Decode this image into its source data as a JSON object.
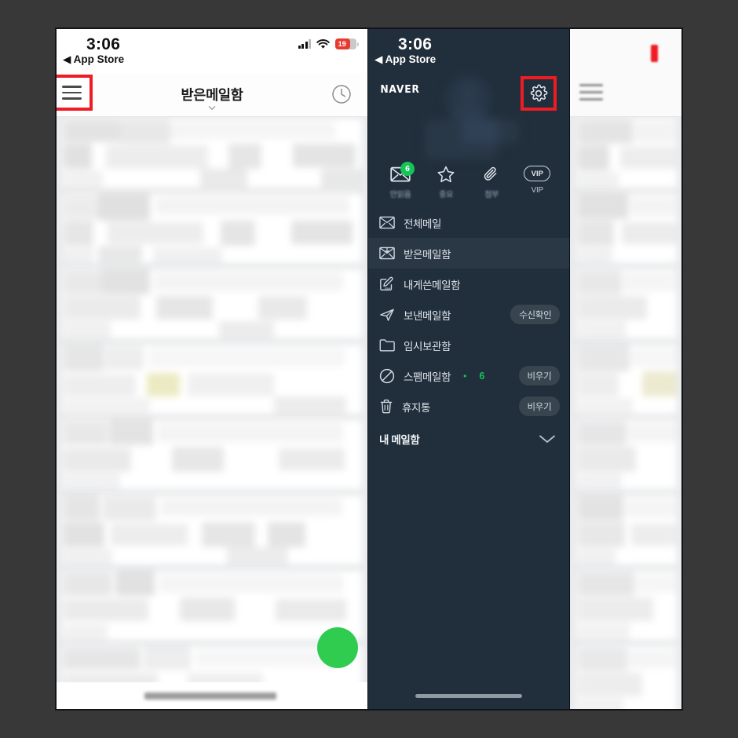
{
  "meta": {
    "outer_bg": "#383838",
    "accent_red": "#ee1c24",
    "accent_green": "#16c45a",
    "dark_panel_bg": "#212e3b",
    "active_row_bg": "#2a3744"
  },
  "left_panel": {
    "status_bar": {
      "time": "3:06",
      "back_label": "App Store",
      "back_arrow": "◀",
      "battery_percent": "19",
      "signal_icon": "signal-bars-icon",
      "wifi_icon": "wifi-icon",
      "battery_icon": "battery-icon"
    },
    "navbar": {
      "menu_icon": "hamburger-menu-icon",
      "title": "받은메일함",
      "caret_icon": "chevron-down-icon",
      "clock_icon": "clock-icon"
    },
    "compose_button": "compose-fab",
    "list_items": [
      {
        "id": "mail-1"
      },
      {
        "id": "mail-2"
      },
      {
        "id": "mail-3"
      },
      {
        "id": "mail-4"
      },
      {
        "id": "mail-5"
      },
      {
        "id": "mail-6"
      },
      {
        "id": "mail-7"
      },
      {
        "id": "mail-8"
      }
    ]
  },
  "mid_panel": {
    "status_bar": {
      "time": "3:06",
      "back_label": "App Store",
      "back_arrow": "◀"
    },
    "brand": "NAVER",
    "settings_icon": "gear-icon",
    "avatar": "user-avatar",
    "quick_access": [
      {
        "icon": "unread-envelope-icon",
        "label": "안읽음",
        "badge": "6"
      },
      {
        "icon": "star-icon",
        "label": "중요",
        "badge": ""
      },
      {
        "icon": "paperclip-icon",
        "label": "첨부",
        "badge": ""
      },
      {
        "icon": "vip-badge-icon",
        "label": "VIP",
        "badge": "",
        "pill_text": "VIP"
      }
    ],
    "menu": [
      {
        "icon": "envelope-icon",
        "label": "전체메일",
        "pill": "",
        "count": "",
        "active": false
      },
      {
        "icon": "inbox-envelope-icon",
        "label": "받은메일함",
        "pill": "",
        "count": "",
        "active": true
      },
      {
        "icon": "self-note-icon",
        "label": "내게쓴메일함",
        "pill": "",
        "count": "",
        "active": false
      },
      {
        "icon": "send-icon",
        "label": "보낸메일함",
        "pill": "수신확인",
        "count": "",
        "active": false
      },
      {
        "icon": "folder-icon",
        "label": "임시보관함",
        "pill": "",
        "count": "",
        "active": false
      },
      {
        "icon": "block-icon",
        "label": "스팸메일함",
        "pill": "비우기",
        "count": "6",
        "active": false
      },
      {
        "icon": "trash-icon",
        "label": "휴지통",
        "pill": "비우기",
        "count": "",
        "active": false
      }
    ],
    "section": {
      "label": "내 메일함",
      "chevron_icon": "chevron-down-icon"
    },
    "home_indicator": "home-indicator"
  },
  "right_panel": {
    "menu_icon": "hamburger-menu-icon",
    "red_mark": "red-highlight-mark",
    "list_items": [
      {
        "id": "r-mail-1"
      },
      {
        "id": "r-mail-2"
      },
      {
        "id": "r-mail-3"
      },
      {
        "id": "r-mail-4"
      },
      {
        "id": "r-mail-5"
      },
      {
        "id": "r-mail-6"
      },
      {
        "id": "r-mail-7"
      },
      {
        "id": "r-mail-8"
      }
    ]
  }
}
